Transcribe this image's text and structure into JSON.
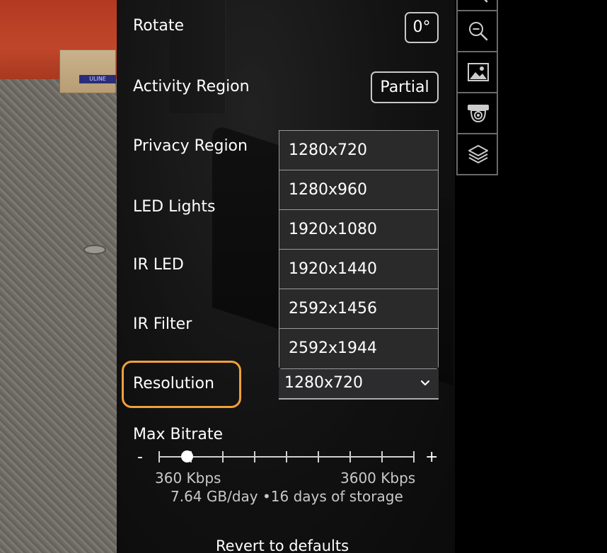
{
  "settings": {
    "rotate": {
      "label": "Rotate",
      "value": "0°"
    },
    "activity_region": {
      "label": "Activity Region",
      "value": "Partial"
    },
    "privacy_region": {
      "label": "Privacy Region"
    },
    "led_lights": {
      "label": "LED Lights"
    },
    "ir_led": {
      "label": "IR LED"
    },
    "ir_filter": {
      "label": "IR Filter"
    },
    "resolution": {
      "label": "Resolution",
      "selected": "1280x720",
      "options": [
        "1280x720",
        "1280x960",
        "1920x1080",
        "1920x1440",
        "2592x1456",
        "2592x1944"
      ]
    },
    "max_bitrate": {
      "label": "Max Bitrate",
      "minus": "-",
      "plus": "+",
      "min_label": "360 Kbps",
      "max_label": "3600 Kbps",
      "value_fraction": 0.11,
      "storage_text": "7.64 GB/day •16 days of storage"
    },
    "revert_label": "Revert to defaults"
  },
  "feed": {
    "box_label": "ULINE"
  },
  "toolbar": {
    "items": [
      "zoom-in-icon",
      "zoom-out-icon",
      "image-icon",
      "camera-icon",
      "layers-icon"
    ]
  },
  "colors": {
    "highlight": "#f0a03c",
    "panel_bg": "#2a2a2b"
  }
}
